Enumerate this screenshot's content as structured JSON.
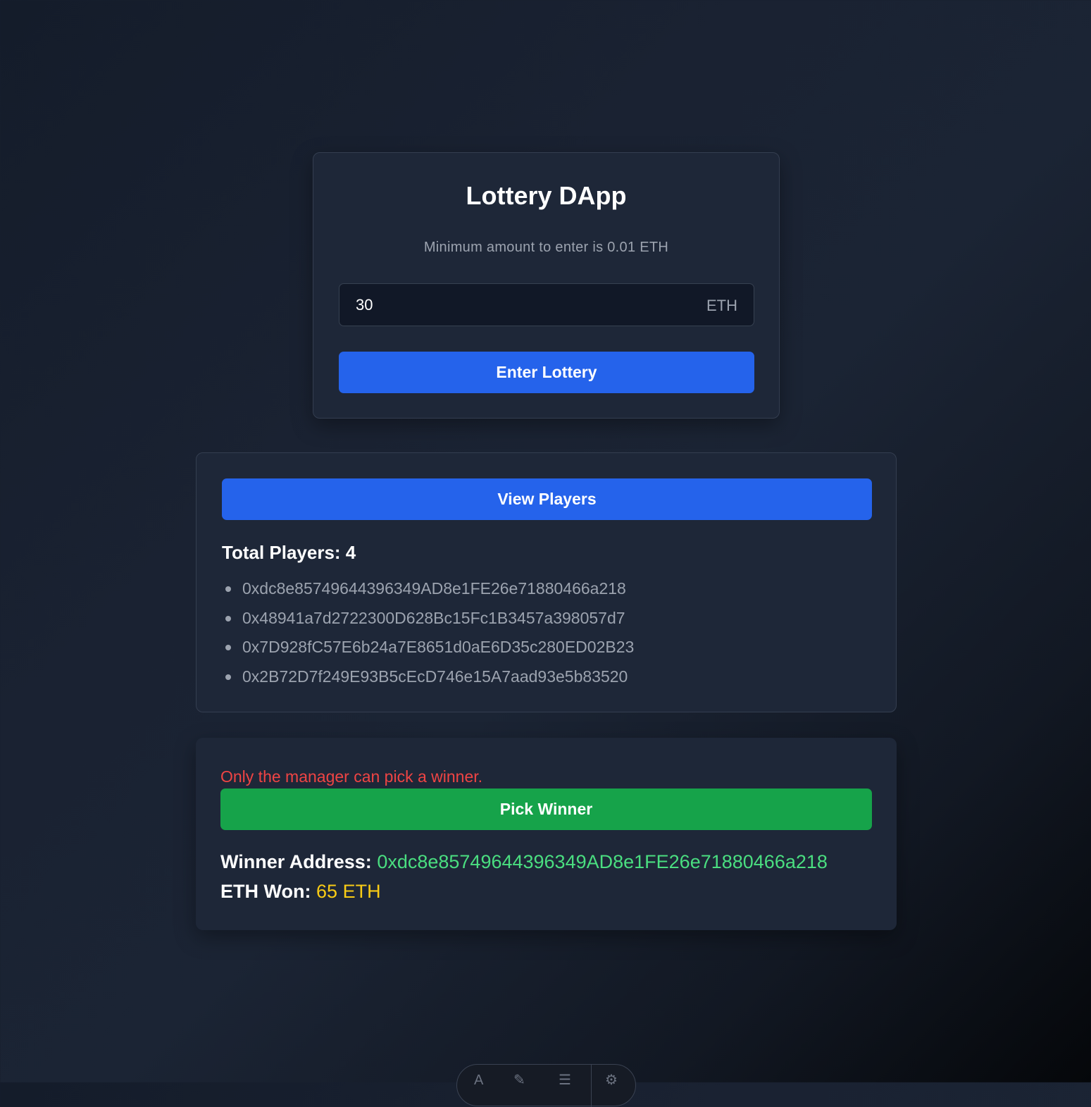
{
  "enter_card": {
    "title": "Lottery DApp",
    "subtitle": "Minimum amount to enter is 0.01 ETH",
    "amount_value": "30",
    "amount_unit": "ETH",
    "enter_button_label": "Enter Lottery"
  },
  "players_card": {
    "view_button_label": "View Players",
    "total_players_text": "Total Players: 4",
    "players": [
      "0xdc8e85749644396349AD8e1FE26e71880466a218",
      "0x48941a7d2722300D628Bc15Fc1B3457a398057d7",
      "0x7D928fC57E6b24a7E8651d0aE6D35c280ED02B23",
      "0x2B72D7f249E93B5cEcD746e15A7aad93e5b83520"
    ]
  },
  "winner_card": {
    "error_message": "Only the manager can pick a winner.",
    "pick_button_label": "Pick Winner",
    "winner_label": "Winner Address:",
    "winner_address": "0xdc8e85749644396349AD8e1FE26e71880466a218",
    "eth_won_label": "ETH Won:",
    "eth_won_value": "65",
    "eth_won_unit": "ETH"
  },
  "colors": {
    "primary_button": "#2563eb",
    "success_button": "#16a34a",
    "error_text": "#ef4444",
    "winner_address": "#4ade80",
    "eth_won": "#facc15"
  },
  "dock": {
    "icons": [
      "font-icon",
      "brush-icon",
      "menu-icon",
      "gear-icon"
    ]
  }
}
